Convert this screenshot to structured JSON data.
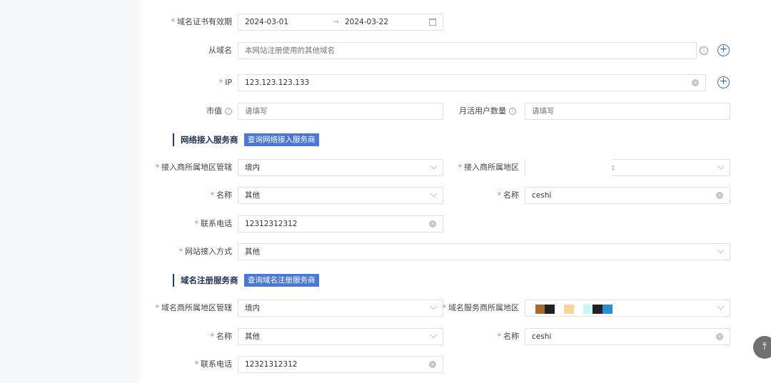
{
  "form": {
    "cert_validity": {
      "label": "域名证书有效期",
      "start": "2024-03-01",
      "separator": "→",
      "end": "2024-03-22"
    },
    "sub_domain": {
      "label": "从域名",
      "placeholder": "本网站注册使用的其他域名"
    },
    "ip": {
      "label": "IP",
      "value": "123.123.123.133"
    },
    "market_value": {
      "label": "市值",
      "placeholder": "请填写"
    },
    "mau": {
      "label": "月活用户数量",
      "placeholder": "请填写"
    }
  },
  "network_section": {
    "title": "网络接入服务商",
    "query_button": "查询网络接入服务商",
    "region_admin": {
      "label": "接入商所属地区管辖",
      "value": "境内"
    },
    "region": {
      "label": "接入商所属地区",
      "value": ":"
    },
    "name_select": {
      "label": "名称",
      "value": "其他"
    },
    "name_input": {
      "label": "名称",
      "value": "ceshi"
    },
    "phone": {
      "label": "联系电话",
      "value": "12312312312"
    },
    "access_method": {
      "label": "网站接入方式",
      "value": "其他"
    }
  },
  "registrar_section": {
    "title": "域名注册服务商",
    "query_button": "查询域名注册服务商",
    "region_admin": {
      "label": "域名商所属地区管辖",
      "value": "境内"
    },
    "region": {
      "label": "域名服务商所属地区",
      "redacted_colors": [
        "#a86a2c",
        "#222222",
        "#fbd49a",
        "#c8f6fa",
        "#222222",
        "#2a8fd0"
      ]
    },
    "name_select": {
      "label": "名称",
      "value": "其他"
    },
    "name_input": {
      "label": "名称",
      "value": "ceshi"
    },
    "phone": {
      "label": "联系电话",
      "value": "12321312312"
    }
  },
  "icons": {
    "info": "info-circle-icon",
    "plus": "plus-circle-icon",
    "calendar": "calendar-icon",
    "clear": "clear-icon",
    "chevron": "chevron-down-icon",
    "back_to_top": "back-to-top-icon"
  }
}
